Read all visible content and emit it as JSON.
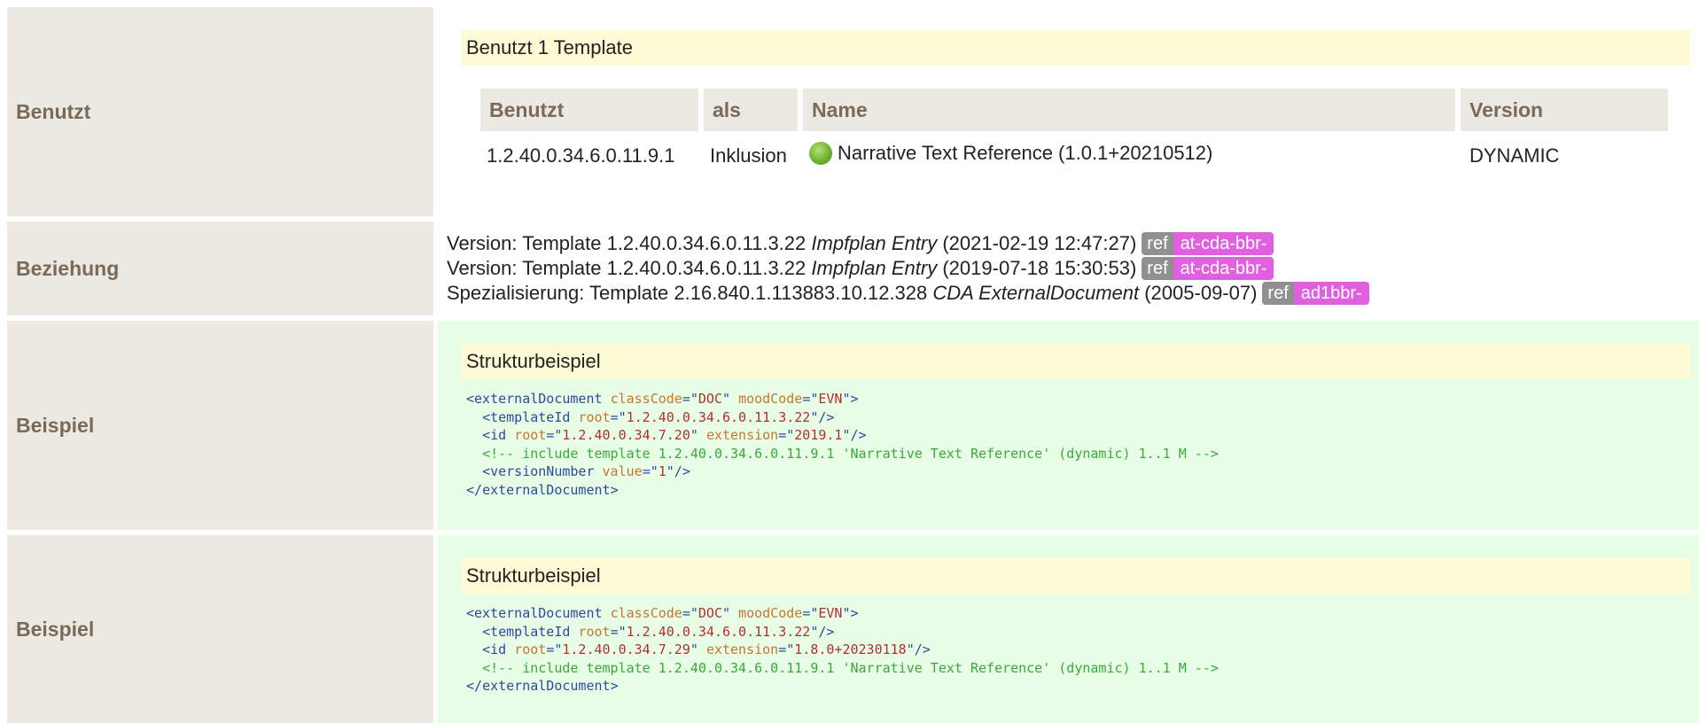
{
  "rows": {
    "benutzt": {
      "label": "Benutzt",
      "box_title": "Benutzt 1 Template",
      "headers": [
        "Benutzt",
        "als",
        "Name",
        "Version"
      ],
      "row": {
        "id": "1.2.40.0.34.6.0.11.9.1",
        "als": "Inklusion",
        "status_icon": "green-circle-icon",
        "name": "Narrative Text Reference (1.0.1+20210512)",
        "version": "DYNAMIC"
      }
    },
    "beziehung": {
      "label": "Beziehung",
      "lines": [
        {
          "prefix": "Version: Template 1.2.40.0.34.6.0.11.3.22",
          "name": "Impfplan Entry",
          "date": "(2021‑02‑19 12:47:27)",
          "ref": "ref",
          "project": "at-cda-bbr-"
        },
        {
          "prefix": "Version: Template 1.2.40.0.34.6.0.11.3.22",
          "name": "Impfplan Entry",
          "date": "(2019‑07‑18 15:30:53)",
          "ref": "ref",
          "project": "at-cda-bbr-"
        },
        {
          "prefix": "Spezialisierung: Template 2.16.840.1.113883.10.12.328",
          "name": "CDA ExternalDocument",
          "date": "(2005‑09‑07)",
          "ref": "ref",
          "project": "ad1bbr-"
        }
      ]
    },
    "beispiel1": {
      "label": "Beispiel",
      "box_title": "Strukturbeispiel",
      "code": {
        "open_tag": "externalDocument",
        "classCode": "DOC",
        "moodCode": "EVN",
        "templateId_root": "1.2.40.0.34.6.0.11.3.22",
        "id_root": "1.2.40.0.34.7.20",
        "id_extension": "2019.1",
        "comment": "<!-- include template 1.2.40.0.34.6.0.11.9.1 'Narrative Text Reference' (dynamic) 1..1 M -->",
        "versionNumber_value": "1"
      }
    },
    "beispiel2": {
      "label": "Beispiel",
      "box_title": "Strukturbeispiel",
      "code": {
        "open_tag": "externalDocument",
        "classCode": "DOC",
        "moodCode": "EVN",
        "templateId_root": "1.2.40.0.34.6.0.11.3.22",
        "id_root": "1.2.40.0.34.7.29",
        "id_extension": "1.8.0+20230118",
        "comment": "<!-- include template 1.2.40.0.34.6.0.11.9.1 'Narrative Text Reference' (dynamic) 1..1 M -->"
      }
    }
  },
  "colors": {
    "label_bg": "#ece9e3",
    "label_text": "#7a6a58",
    "title_bg": "#fdfbd6",
    "example_bg": "#e7fde6",
    "ref_badge": "#909090",
    "project_badge": "#e060e0"
  }
}
